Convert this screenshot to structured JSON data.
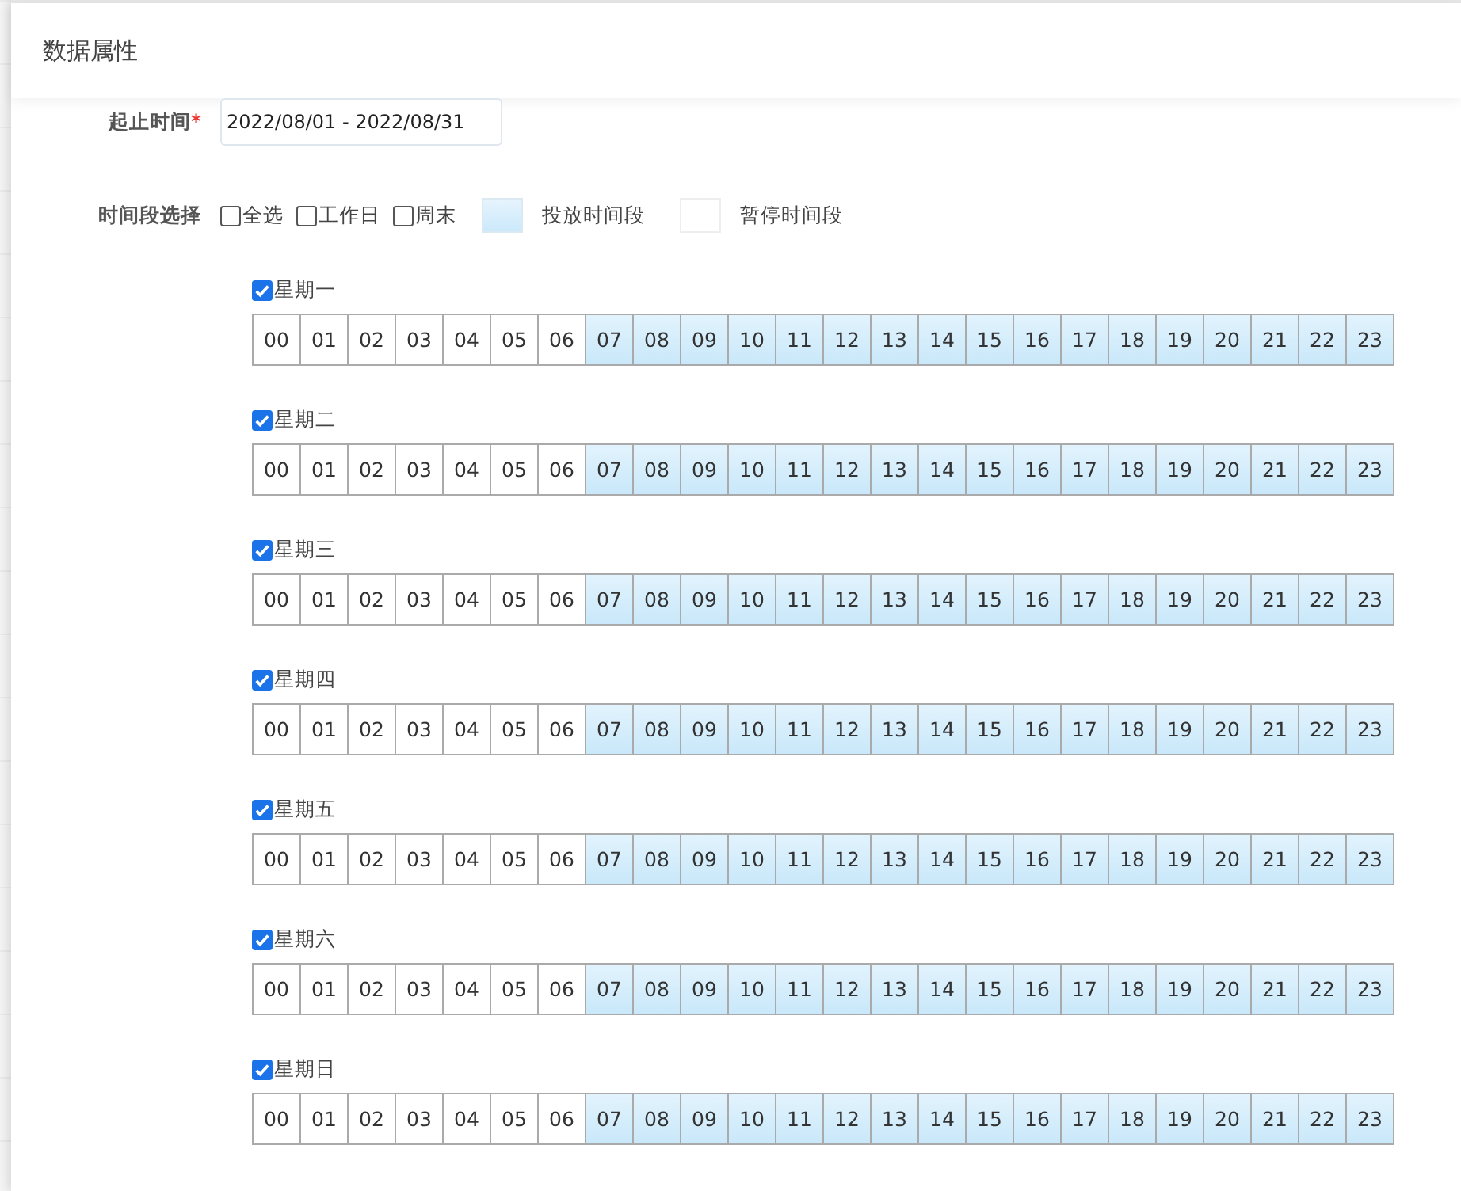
{
  "dialog": {
    "title": "数据属性"
  },
  "date_range": {
    "label": "起止时间",
    "required_mark": "*",
    "value": "2022/08/01 - 2022/08/31"
  },
  "period": {
    "label": "时间段选择",
    "options": [
      {
        "label": "全选",
        "checked": false
      },
      {
        "label": "工作日",
        "checked": false
      },
      {
        "label": "周末",
        "checked": false
      }
    ],
    "legend": [
      {
        "label": "投放时间段",
        "selected": true
      },
      {
        "label": "暂停时间段",
        "selected": false
      }
    ]
  },
  "days": [
    {
      "label": "星期一",
      "checked": true,
      "hours": [
        {
          "label": "00",
          "selected": false
        },
        {
          "label": "01",
          "selected": false
        },
        {
          "label": "02",
          "selected": false
        },
        {
          "label": "03",
          "selected": false
        },
        {
          "label": "04",
          "selected": false
        },
        {
          "label": "05",
          "selected": false
        },
        {
          "label": "06",
          "selected": false
        },
        {
          "label": "07",
          "selected": true
        },
        {
          "label": "08",
          "selected": true
        },
        {
          "label": "09",
          "selected": true
        },
        {
          "label": "10",
          "selected": true
        },
        {
          "label": "11",
          "selected": true
        },
        {
          "label": "12",
          "selected": true
        },
        {
          "label": "13",
          "selected": true
        },
        {
          "label": "14",
          "selected": true
        },
        {
          "label": "15",
          "selected": true
        },
        {
          "label": "16",
          "selected": true
        },
        {
          "label": "17",
          "selected": true
        },
        {
          "label": "18",
          "selected": true
        },
        {
          "label": "19",
          "selected": true
        },
        {
          "label": "20",
          "selected": true
        },
        {
          "label": "21",
          "selected": true
        },
        {
          "label": "22",
          "selected": true
        },
        {
          "label": "23",
          "selected": true
        }
      ]
    },
    {
      "label": "星期二",
      "checked": true,
      "hours": [
        {
          "label": "00",
          "selected": false
        },
        {
          "label": "01",
          "selected": false
        },
        {
          "label": "02",
          "selected": false
        },
        {
          "label": "03",
          "selected": false
        },
        {
          "label": "04",
          "selected": false
        },
        {
          "label": "05",
          "selected": false
        },
        {
          "label": "06",
          "selected": false
        },
        {
          "label": "07",
          "selected": true
        },
        {
          "label": "08",
          "selected": true
        },
        {
          "label": "09",
          "selected": true
        },
        {
          "label": "10",
          "selected": true
        },
        {
          "label": "11",
          "selected": true
        },
        {
          "label": "12",
          "selected": true
        },
        {
          "label": "13",
          "selected": true
        },
        {
          "label": "14",
          "selected": true
        },
        {
          "label": "15",
          "selected": true
        },
        {
          "label": "16",
          "selected": true
        },
        {
          "label": "17",
          "selected": true
        },
        {
          "label": "18",
          "selected": true
        },
        {
          "label": "19",
          "selected": true
        },
        {
          "label": "20",
          "selected": true
        },
        {
          "label": "21",
          "selected": true
        },
        {
          "label": "22",
          "selected": true
        },
        {
          "label": "23",
          "selected": true
        }
      ]
    },
    {
      "label": "星期三",
      "checked": true,
      "hours": [
        {
          "label": "00",
          "selected": false
        },
        {
          "label": "01",
          "selected": false
        },
        {
          "label": "02",
          "selected": false
        },
        {
          "label": "03",
          "selected": false
        },
        {
          "label": "04",
          "selected": false
        },
        {
          "label": "05",
          "selected": false
        },
        {
          "label": "06",
          "selected": false
        },
        {
          "label": "07",
          "selected": true
        },
        {
          "label": "08",
          "selected": true
        },
        {
          "label": "09",
          "selected": true
        },
        {
          "label": "10",
          "selected": true
        },
        {
          "label": "11",
          "selected": true
        },
        {
          "label": "12",
          "selected": true
        },
        {
          "label": "13",
          "selected": true
        },
        {
          "label": "14",
          "selected": true
        },
        {
          "label": "15",
          "selected": true
        },
        {
          "label": "16",
          "selected": true
        },
        {
          "label": "17",
          "selected": true
        },
        {
          "label": "18",
          "selected": true
        },
        {
          "label": "19",
          "selected": true
        },
        {
          "label": "20",
          "selected": true
        },
        {
          "label": "21",
          "selected": true
        },
        {
          "label": "22",
          "selected": true
        },
        {
          "label": "23",
          "selected": true
        }
      ]
    },
    {
      "label": "星期四",
      "checked": true,
      "hours": [
        {
          "label": "00",
          "selected": false
        },
        {
          "label": "01",
          "selected": false
        },
        {
          "label": "02",
          "selected": false
        },
        {
          "label": "03",
          "selected": false
        },
        {
          "label": "04",
          "selected": false
        },
        {
          "label": "05",
          "selected": false
        },
        {
          "label": "06",
          "selected": false
        },
        {
          "label": "07",
          "selected": true
        },
        {
          "label": "08",
          "selected": true
        },
        {
          "label": "09",
          "selected": true
        },
        {
          "label": "10",
          "selected": true
        },
        {
          "label": "11",
          "selected": true
        },
        {
          "label": "12",
          "selected": true
        },
        {
          "label": "13",
          "selected": true
        },
        {
          "label": "14",
          "selected": true
        },
        {
          "label": "15",
          "selected": true
        },
        {
          "label": "16",
          "selected": true
        },
        {
          "label": "17",
          "selected": true
        },
        {
          "label": "18",
          "selected": true
        },
        {
          "label": "19",
          "selected": true
        },
        {
          "label": "20",
          "selected": true
        },
        {
          "label": "21",
          "selected": true
        },
        {
          "label": "22",
          "selected": true
        },
        {
          "label": "23",
          "selected": true
        }
      ]
    },
    {
      "label": "星期五",
      "checked": true,
      "hours": [
        {
          "label": "00",
          "selected": false
        },
        {
          "label": "01",
          "selected": false
        },
        {
          "label": "02",
          "selected": false
        },
        {
          "label": "03",
          "selected": false
        },
        {
          "label": "04",
          "selected": false
        },
        {
          "label": "05",
          "selected": false
        },
        {
          "label": "06",
          "selected": false
        },
        {
          "label": "07",
          "selected": true
        },
        {
          "label": "08",
          "selected": true
        },
        {
          "label": "09",
          "selected": true
        },
        {
          "label": "10",
          "selected": true
        },
        {
          "label": "11",
          "selected": true
        },
        {
          "label": "12",
          "selected": true
        },
        {
          "label": "13",
          "selected": true
        },
        {
          "label": "14",
          "selected": true
        },
        {
          "label": "15",
          "selected": true
        },
        {
          "label": "16",
          "selected": true
        },
        {
          "label": "17",
          "selected": true
        },
        {
          "label": "18",
          "selected": true
        },
        {
          "label": "19",
          "selected": true
        },
        {
          "label": "20",
          "selected": true
        },
        {
          "label": "21",
          "selected": true
        },
        {
          "label": "22",
          "selected": true
        },
        {
          "label": "23",
          "selected": true
        }
      ]
    },
    {
      "label": "星期六",
      "checked": true,
      "hours": [
        {
          "label": "00",
          "selected": false
        },
        {
          "label": "01",
          "selected": false
        },
        {
          "label": "02",
          "selected": false
        },
        {
          "label": "03",
          "selected": false
        },
        {
          "label": "04",
          "selected": false
        },
        {
          "label": "05",
          "selected": false
        },
        {
          "label": "06",
          "selected": false
        },
        {
          "label": "07",
          "selected": true
        },
        {
          "label": "08",
          "selected": true
        },
        {
          "label": "09",
          "selected": true
        },
        {
          "label": "10",
          "selected": true
        },
        {
          "label": "11",
          "selected": true
        },
        {
          "label": "12",
          "selected": true
        },
        {
          "label": "13",
          "selected": true
        },
        {
          "label": "14",
          "selected": true
        },
        {
          "label": "15",
          "selected": true
        },
        {
          "label": "16",
          "selected": true
        },
        {
          "label": "17",
          "selected": true
        },
        {
          "label": "18",
          "selected": true
        },
        {
          "label": "19",
          "selected": true
        },
        {
          "label": "20",
          "selected": true
        },
        {
          "label": "21",
          "selected": true
        },
        {
          "label": "22",
          "selected": true
        },
        {
          "label": "23",
          "selected": true
        }
      ]
    },
    {
      "label": "星期日",
      "checked": true,
      "hours": [
        {
          "label": "00",
          "selected": false
        },
        {
          "label": "01",
          "selected": false
        },
        {
          "label": "02",
          "selected": false
        },
        {
          "label": "03",
          "selected": false
        },
        {
          "label": "04",
          "selected": false
        },
        {
          "label": "05",
          "selected": false
        },
        {
          "label": "06",
          "selected": false
        },
        {
          "label": "07",
          "selected": true
        },
        {
          "label": "08",
          "selected": true
        },
        {
          "label": "09",
          "selected": true
        },
        {
          "label": "10",
          "selected": true
        },
        {
          "label": "11",
          "selected": true
        },
        {
          "label": "12",
          "selected": true
        },
        {
          "label": "13",
          "selected": true
        },
        {
          "label": "14",
          "selected": true
        },
        {
          "label": "15",
          "selected": true
        },
        {
          "label": "16",
          "selected": true
        },
        {
          "label": "17",
          "selected": true
        },
        {
          "label": "18",
          "selected": true
        },
        {
          "label": "19",
          "selected": true
        },
        {
          "label": "20",
          "selected": true
        },
        {
          "label": "21",
          "selected": true
        },
        {
          "label": "22",
          "selected": true
        },
        {
          "label": "23",
          "selected": true
        }
      ]
    }
  ]
}
